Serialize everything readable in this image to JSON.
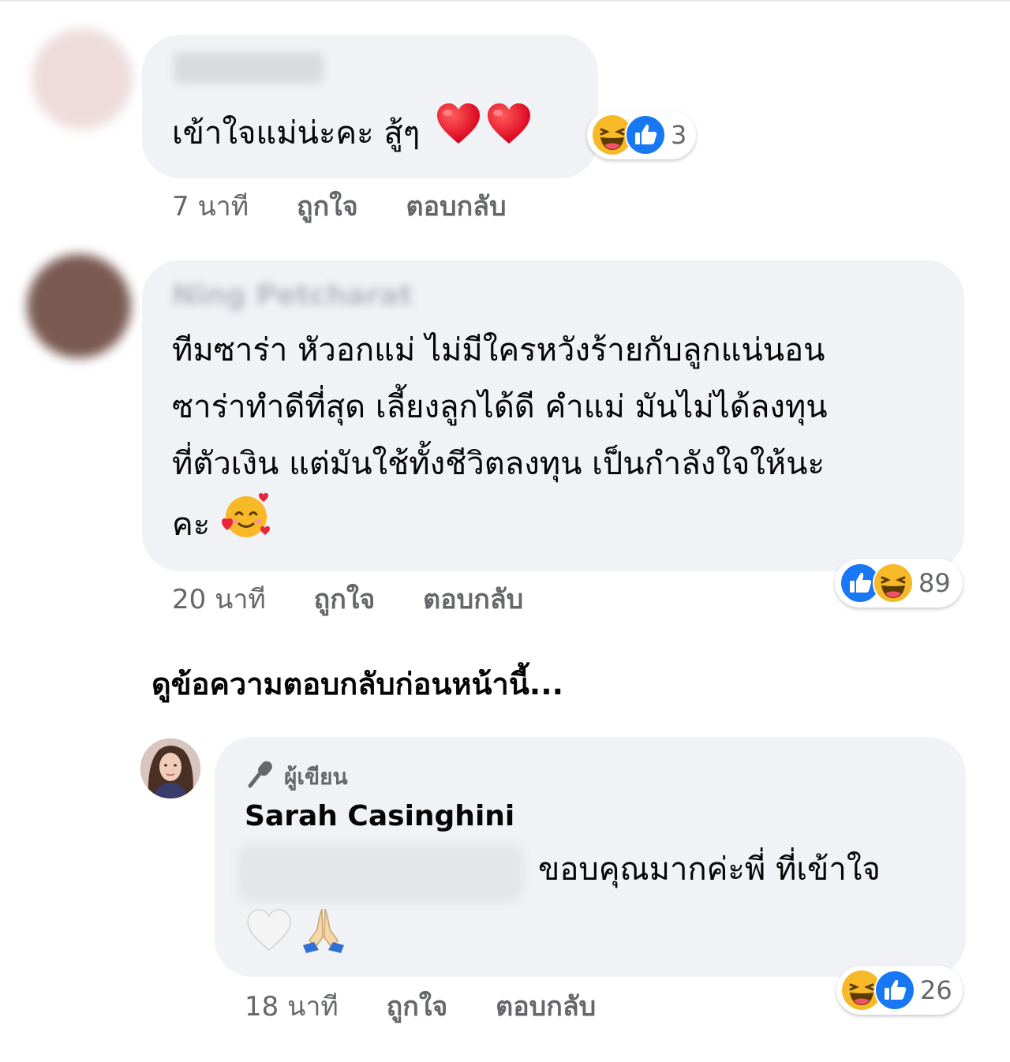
{
  "comments": [
    {
      "text_lines": [
        "เข้าใจแม่น่ะคะ สู้ๆ"
      ],
      "emoji": [
        "red-heart",
        "red-heart"
      ],
      "reactions": {
        "icons": [
          "haha",
          "like"
        ],
        "count": "3"
      },
      "time": "7 นาที",
      "like_label": "ถูกใจ",
      "reply_label": "ตอบกลับ"
    },
    {
      "name": "Ning Petcharat",
      "text_lines": [
        "ทีมซาร่า หัวอกแม่ ไม่มีใครหวังร้ายกับลูกแน่นอน",
        "ซาร่าทำดีที่สุด เลี้ยงลูกได้ดี คำแม่ มันไม่ได้ลงทุน",
        "ที่ตัวเงิน แต่มันใช้ทั้งชีวิตลงทุน เป็นกำลังใจให้นะ",
        "คะ"
      ],
      "emoji": [
        "smiling-face-with-hearts"
      ],
      "reactions": {
        "icons": [
          "like",
          "haha"
        ],
        "count": "89"
      },
      "time": "20 นาที",
      "like_label": "ถูกใจ",
      "reply_label": "ตอบกลับ"
    }
  ],
  "view_previous_replies": "ดูข้อความตอบกลับก่อนหน้านี้...",
  "reply": {
    "author_badge": "ผู้เขียน",
    "name": "Sarah Casinghini",
    "text": "ขอบคุณมากค่ะพี่ ที่เข้าใจ",
    "emoji": [
      "white-heart",
      "folded-hands"
    ],
    "reactions": {
      "icons": [
        "haha",
        "like"
      ],
      "count": "26"
    },
    "time": "18 นาที",
    "like_label": "ถูกใจ",
    "reply_label": "ตอบกลับ"
  },
  "colors": {
    "bubble": "#f0f2f5",
    "like_blue": "#1877f2",
    "haha_yellow": "#f7b928",
    "meta_gray": "#65676b"
  }
}
